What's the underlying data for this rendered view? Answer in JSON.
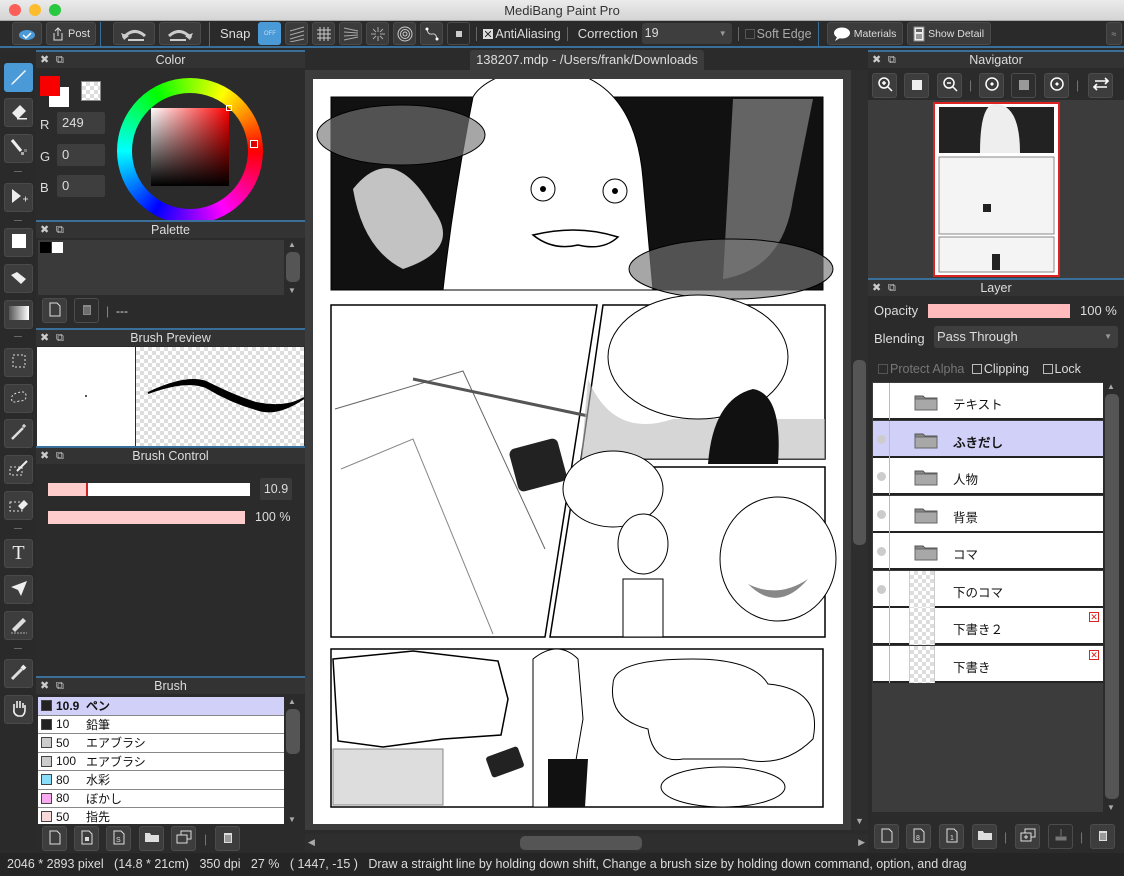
{
  "window": {
    "title": "MediBang Paint Pro"
  },
  "toolbar": {
    "post_label": "Post",
    "snap_label": "Snap",
    "snap_off_label": "OFF",
    "antialiasing_label": "AntiAliasing",
    "antialiasing_checked": true,
    "correction_label": "Correction",
    "correction_value": "19",
    "soft_edge_label": "Soft Edge",
    "soft_edge_checked": false,
    "materials_label": "Materials",
    "show_detail_label": "Show Detail"
  },
  "tools": [
    "pen-tool",
    "eraser-tool",
    "dot-pen-tool",
    "move-tool",
    "fill-rect-tool",
    "bucket-tool",
    "gradient-tool",
    "rect-select-tool",
    "lasso-tool",
    "magic-wand-tool",
    "select-pen-tool",
    "select-eraser-tool",
    "text-tool",
    "operation-tool",
    "divide-tool",
    "eyedropper-tool",
    "hand-tool"
  ],
  "color_panel": {
    "title": "Color",
    "fg_color": "#f90000",
    "bg_color": "#ffffff",
    "r_label": "R",
    "r_value": "249",
    "g_label": "G",
    "g_value": "0",
    "b_label": "B",
    "b_value": "0"
  },
  "palette_panel": {
    "title": "Palette",
    "swatches": [
      "#000000",
      "#ffffff"
    ],
    "name": "---"
  },
  "brush_preview_panel": {
    "title": "Brush Preview"
  },
  "brush_control_panel": {
    "title": "Brush Control",
    "size_value": "10.9",
    "size_fraction": 0.2,
    "opacity_value": "100 %",
    "opacity_fraction": 1.0
  },
  "brush_panel": {
    "title": "Brush",
    "items": [
      {
        "size": "10.9",
        "name": "ペン",
        "color": "#222222",
        "selected": true
      },
      {
        "size": "10",
        "name": "鉛筆",
        "color": "#222222",
        "selected": false
      },
      {
        "size": "50",
        "name": "エアブラシ",
        "color": "#cccccc",
        "selected": false
      },
      {
        "size": "100",
        "name": "エアブラシ",
        "color": "#cccccc",
        "selected": false
      },
      {
        "size": "80",
        "name": "水彩",
        "color": "#88ddf8",
        "selected": false
      },
      {
        "size": "80",
        "name": "ぼかし",
        "color": "#f8aaf0",
        "selected": false
      },
      {
        "size": "50",
        "name": "指先",
        "color": "#f8d8d8",
        "selected": false
      }
    ]
  },
  "document": {
    "tab_label": "138207.mdp - /Users/frank/Downloads"
  },
  "navigator_panel": {
    "title": "Navigator"
  },
  "layer_panel": {
    "title": "Layer",
    "opacity_label": "Opacity",
    "opacity_value": "100 %",
    "blending_label": "Blending",
    "blending_value": "Pass Through",
    "protect_alpha_label": "Protect Alpha",
    "clipping_label": "Clipping",
    "lock_label": "Lock",
    "layers": [
      {
        "name": "テキスト",
        "type": "folder",
        "visible": false,
        "selected": false,
        "mask": false
      },
      {
        "name": "ふきだし",
        "type": "folder",
        "visible": true,
        "selected": true,
        "mask": false
      },
      {
        "name": "人物",
        "type": "folder",
        "visible": true,
        "selected": false,
        "mask": false
      },
      {
        "name": "背景",
        "type": "folder",
        "visible": true,
        "selected": false,
        "mask": false
      },
      {
        "name": "コマ",
        "type": "folder",
        "visible": true,
        "selected": false,
        "mask": false
      },
      {
        "name": "下のコマ",
        "type": "layer",
        "visible": true,
        "selected": false,
        "mask": false
      },
      {
        "name": "下書き２",
        "type": "layer",
        "visible": false,
        "selected": false,
        "mask": true
      },
      {
        "name": "下書き",
        "type": "layer",
        "visible": false,
        "selected": false,
        "mask": true
      }
    ]
  },
  "status": {
    "dimensions": "2046 * 2893 pixel",
    "physical": "(14.8 * 21cm)",
    "dpi": "350 dpi",
    "zoom": "27 %",
    "coords": "( 1447, -15 )",
    "hint": "Draw a straight line by holding down shift, Change a brush size by holding down command, option, and drag"
  }
}
